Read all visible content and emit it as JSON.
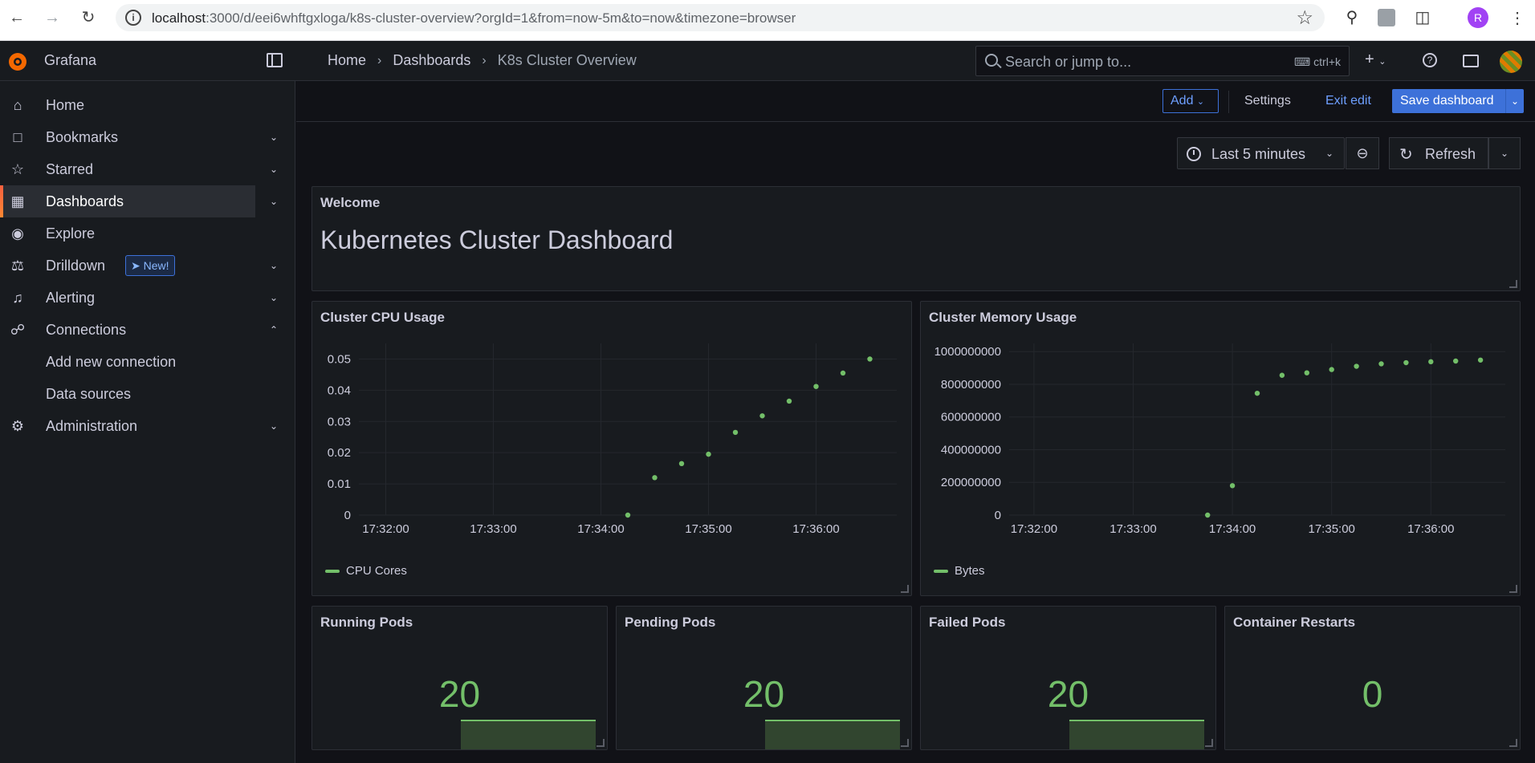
{
  "browser": {
    "url_host": "localhost",
    "url_rest": ":3000/d/eei6whftgxloga/k8s-cluster-overview?orgId=1&from=now-5m&to=now&timezone=browser",
    "profile_initial": "R"
  },
  "app": {
    "brand": "Grafana",
    "breadcrumb": [
      "Home",
      "Dashboards",
      "K8s Cluster Overview"
    ],
    "search_placeholder": "Search or jump to...",
    "search_shortcut": "ctrl+k"
  },
  "sidebar": {
    "items": [
      {
        "label": "Home",
        "icon": "home-icon"
      },
      {
        "label": "Bookmarks",
        "icon": "bookmark-icon"
      },
      {
        "label": "Starred",
        "icon": "star-icon"
      },
      {
        "label": "Dashboards",
        "icon": "apps-icon",
        "active": true
      },
      {
        "label": "Explore",
        "icon": "compass-icon"
      },
      {
        "label": "Drilldown",
        "icon": "drilldown-icon",
        "badge": "New!"
      },
      {
        "label": "Alerting",
        "icon": "bell-icon"
      },
      {
        "label": "Connections",
        "icon": "plug-icon",
        "expanded": true
      },
      {
        "label": "Administration",
        "icon": "cog-icon"
      }
    ],
    "connections_sub": [
      "Add new connection",
      "Data sources"
    ]
  },
  "toolbar": {
    "add_label": "Add",
    "settings_label": "Settings",
    "exit_label": "Exit edit",
    "save_label": "Save dashboard",
    "time_range": "Last 5 minutes",
    "refresh_label": "Refresh"
  },
  "panels": {
    "welcome": {
      "title": "Welcome",
      "text": "Kubernetes Cluster Dashboard"
    },
    "cpu": {
      "title": "Cluster CPU Usage",
      "legend": "CPU Cores"
    },
    "memory": {
      "title": "Cluster Memory Usage",
      "legend": "Bytes"
    },
    "stats": [
      {
        "title": "Running Pods",
        "value": "20",
        "sparkline": true
      },
      {
        "title": "Pending Pods",
        "value": "20",
        "sparkline": true
      },
      {
        "title": "Failed Pods",
        "value": "20",
        "sparkline": true
      },
      {
        "title": "Container Restarts",
        "value": "0",
        "sparkline": false
      }
    ]
  },
  "colors": {
    "accent": "#3d71d9",
    "series": "#73bf69",
    "active_bar": "#ff8833"
  },
  "chart_data": [
    {
      "type": "scatter",
      "title": "Cluster CPU Usage",
      "x": [
        "17:34:15",
        "17:34:30",
        "17:34:45",
        "17:35:00",
        "17:35:15",
        "17:35:30",
        "17:35:45",
        "17:36:00",
        "17:36:15",
        "17:36:30"
      ],
      "series": [
        {
          "name": "CPU Cores",
          "values": [
            0,
            0.012,
            0.0165,
            0.0195,
            0.0265,
            0.0318,
            0.0365,
            0.0412,
            0.0455,
            0.05
          ]
        }
      ],
      "x_ticks": [
        "17:32:00",
        "17:33:00",
        "17:34:00",
        "17:35:00",
        "17:36:00"
      ],
      "y_ticks": [
        "0",
        "0.01",
        "0.02",
        "0.03",
        "0.04",
        "0.05"
      ],
      "ylim": [
        0,
        0.055
      ],
      "xlim": [
        "17:31:45",
        "17:36:45"
      ],
      "grid": true,
      "legend": "bottom-left"
    },
    {
      "type": "scatter",
      "title": "Cluster Memory Usage",
      "x": [
        "17:33:45",
        "17:34:00",
        "17:34:15",
        "17:34:30",
        "17:34:45",
        "17:35:00",
        "17:35:15",
        "17:35:30",
        "17:35:45",
        "17:36:00",
        "17:36:15",
        "17:36:30"
      ],
      "series": [
        {
          "name": "Bytes",
          "values": [
            0,
            180000000,
            745000000,
            855000000,
            870000000,
            890000000,
            910000000,
            925000000,
            932000000,
            938000000,
            942000000,
            948000000
          ]
        }
      ],
      "x_ticks": [
        "17:32:00",
        "17:33:00",
        "17:34:00",
        "17:35:00",
        "17:36:00"
      ],
      "y_ticks": [
        "0",
        "200000000",
        "400000000",
        "600000000",
        "800000000",
        "1000000000"
      ],
      "ylim": [
        0,
        1050000000
      ],
      "xlim": [
        "17:31:45",
        "17:36:45"
      ],
      "grid": true,
      "legend": "bottom-left"
    }
  ]
}
